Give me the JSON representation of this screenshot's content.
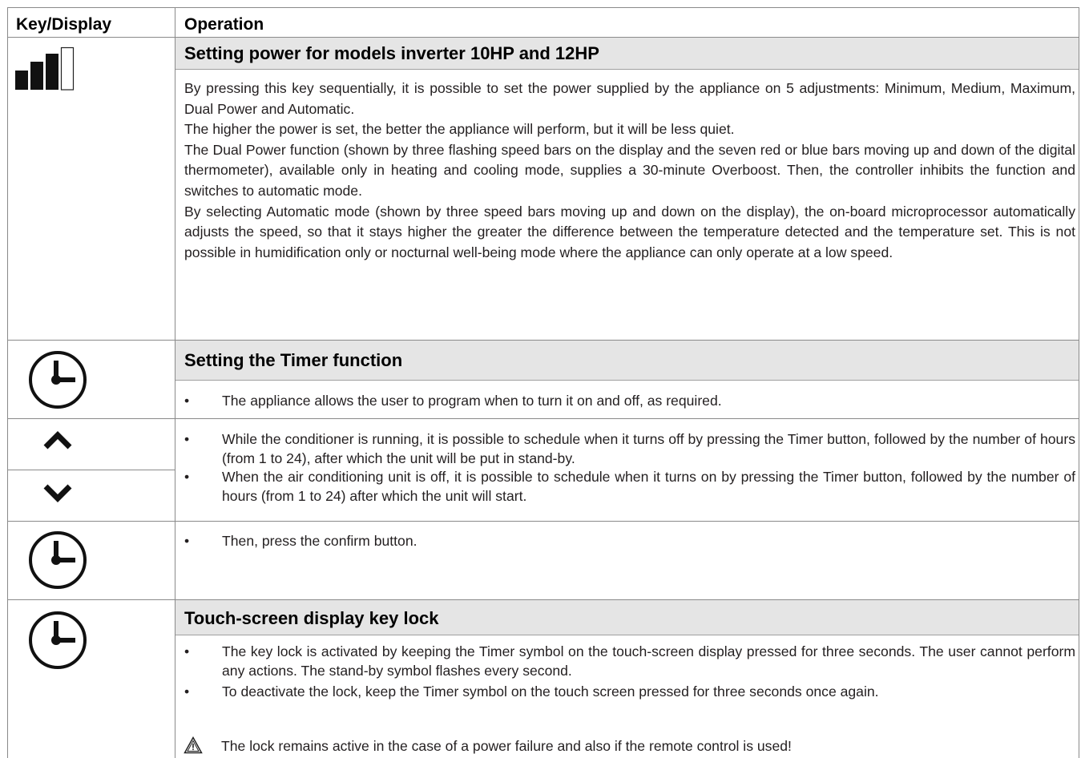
{
  "header": {
    "col1": "Key/Display",
    "col2": "Operation"
  },
  "power": {
    "title": "Setting power for models inverter 10HP and 12HP",
    "icon": "power-level-bars-icon",
    "paragraphs": [
      "By pressing this key sequentially, it is possible to set the power supplied by the appliance on 5 adjustments: Minimum, Medium, Maximum, Dual Power and Automatic.",
      "The higher the power is set, the better the appliance will perform, but it will be less quiet.",
      "The Dual Power function (shown by three flashing speed bars on the display and the seven red or blue bars moving up and down of the digital thermometer), available only in heating and cooling mode, supplies a 30-minute Overboost. Then, the controller inhibits the function and switches to automatic mode.",
      "By selecting Automatic mode (shown by three speed bars moving up and down on the display), the on-board microprocessor automatically adjusts the speed, so that it stays higher the greater the difference between the temperature detected and the temperature set. This is not possible in humidification only or nocturnal well-being mode where the appliance can only operate at a low speed."
    ]
  },
  "timer": {
    "title": "Setting the Timer function",
    "icon": "clock-icon",
    "bullet": "The appliance allows the user to program when to turn it on and off, as required."
  },
  "arrows": {
    "up_icon": "chevron-up-icon",
    "down_icon": "chevron-down-icon",
    "bullets": [
      "While the conditioner is running, it is possible to schedule when it turns off by pressing the Timer button, followed by the number of hours (from 1 to 24), after which the unit will be put in stand-by.",
      "When the air conditioning unit is off, it is possible to schedule when it turns on by pressing the Timer button, followed by the number of hours (from 1 to 24) after which the unit will start."
    ]
  },
  "confirm": {
    "icon": "clock-icon",
    "bullet": " Then, press the confirm button."
  },
  "lock": {
    "title": "Touch-screen display key lock",
    "icon": "clock-icon",
    "bullets": [
      "The key lock is activated by keeping the Timer symbol on the touch-screen display pressed for three seconds. The user cannot perform any actions. The stand-by symbol flashes every second.",
      "To deactivate the lock, keep the Timer symbol on the touch screen pressed for three seconds once again."
    ],
    "warning_icon": "warning-triangle-icon",
    "warning": "The lock remains active in the case of a power failure and also if the remote control is used!",
    "bullet_char": "•"
  }
}
